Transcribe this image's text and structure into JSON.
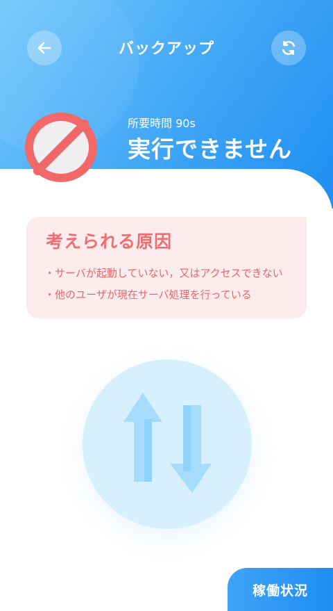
{
  "header": {
    "title": "バックアップ",
    "back_icon": "arrow-left-icon",
    "refresh_icon": "refresh-icon"
  },
  "result": {
    "duration_label": "所要時間 90s",
    "status_text": "実行できません",
    "status_icon": "prohibited-icon"
  },
  "reasons": {
    "heading": "考えられる原因",
    "items": [
      "・サーバが起動していない，又はアクセスできない",
      "・他のユーザが現在サーバ処理を行っている"
    ]
  },
  "graphic": {
    "icon": "transfer-arrows-icon"
  },
  "footer": {
    "status_tab_label": "稼働状況"
  },
  "colors": {
    "brand_blue": "#1f8ef2",
    "error_red": "#f26d6f",
    "reason_bg": "#fdecee"
  }
}
